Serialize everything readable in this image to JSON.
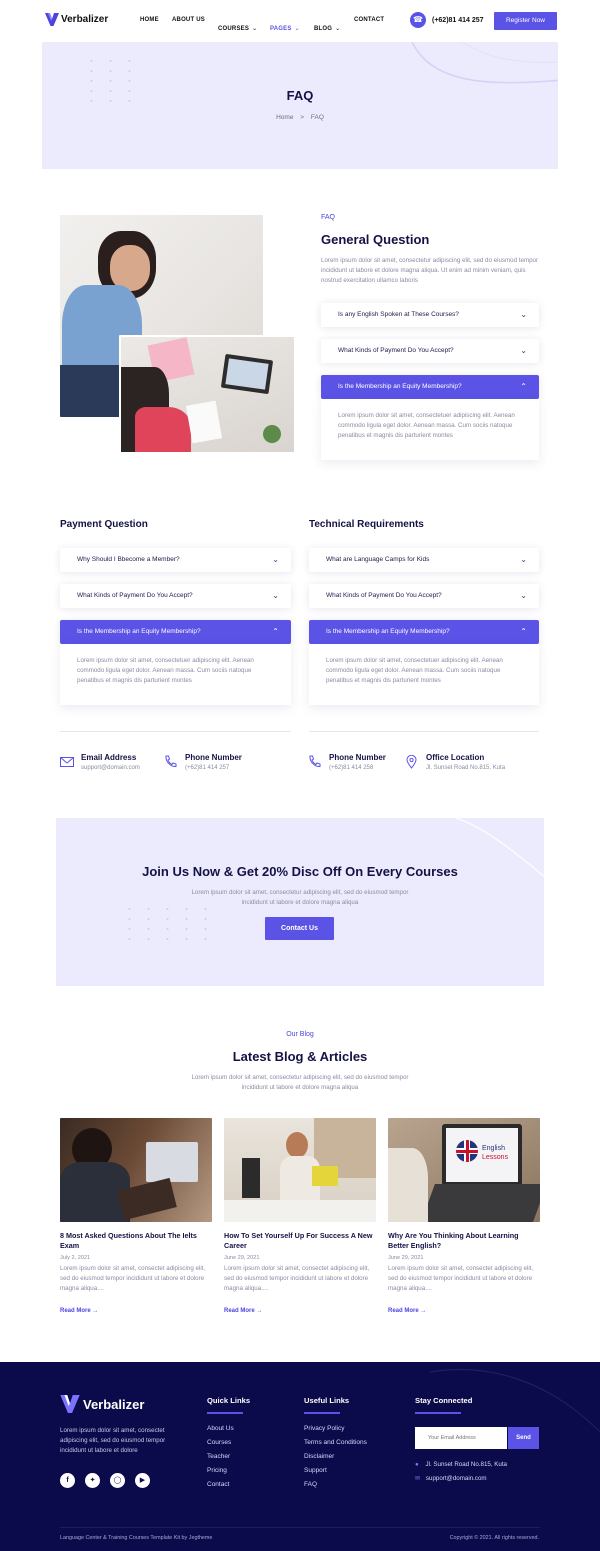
{
  "header": {
    "brand": "Verbalizer",
    "nav": [
      {
        "label": "HOME"
      },
      {
        "label": "ABOUT US"
      },
      {
        "label": "COURSES"
      },
      {
        "label": "PAGES"
      },
      {
        "label": "BLOG"
      },
      {
        "label": "CONTACT"
      }
    ],
    "phone": "(+62)81 414 257",
    "register_label": "Register Now",
    "active_color": "#5a53e6"
  },
  "hero": {
    "title": "FAQ",
    "breadcrumb_home": "Home",
    "breadcrumb_sep": ">",
    "breadcrumb_current": "FAQ"
  },
  "general": {
    "kicker": "FAQ",
    "title": "General Question",
    "intro": "Lorem ipsum dolor sit amet, consectetur adipiscing elit, sed do eiusmod tempor incididunt ut labore et dolore magna aliqua. Ut enim ad minim veniam, quis nostrud exercitation ullamco laboris",
    "items": [
      {
        "q": "Is any English Spoken at These Courses?"
      },
      {
        "q": "What Kinds of Payment Do You Accept?"
      },
      {
        "q": "Is the Membership an Equity Membership?"
      }
    ],
    "answer": "Lorem ipsum dolor sit amet, consectetuer adipiscing elit. Aenean commodo ligula eget dolor. Aenean massa. Cum sociis natoque penatibus et magnis dis parturient montes"
  },
  "payment": {
    "title": "Payment Question",
    "items": [
      {
        "q": "Why Should I Bbecome a Member?"
      },
      {
        "q": "What Kinds of Payment Do You Accept?"
      },
      {
        "q": "Is the Membership an Equity Membership?"
      }
    ],
    "answer": "Lorem ipsum dolor sit amet, consectetuer adipiscing elit. Aenean commodo ligula eget dolor. Aenean massa. Cum sociis natoque penatibus et magnis dis parturient montes"
  },
  "technical": {
    "title": "Technical Requirements",
    "items": [
      {
        "q": "What are Language Camps for Kids"
      },
      {
        "q": "What Kinds of Payment Do You Accept?"
      },
      {
        "q": "Is the Membership an Equity Membership?"
      }
    ],
    "answer": "Lorem ipsum dolor sit amet, consectetuer adipiscing elit. Aenean commodo ligula eget dolor. Aenean massa. Cum sociis natoque penatibus et magnis dis parturient montes"
  },
  "contacts": [
    {
      "label": "Email Address",
      "value": "support@domain.com",
      "icon": "mail-icon"
    },
    {
      "label": "Phone Number",
      "value": "(+62)81 414 257",
      "icon": "phone-icon"
    },
    {
      "label": "Phone Number",
      "value": "(+62)81 414 258",
      "icon": "phone-icon"
    },
    {
      "label": "Office Location",
      "value": "Jl. Sunset Road No.815, Kuta",
      "icon": "location-pin-icon"
    }
  ],
  "cta": {
    "title": "Join Us Now & Get 20% Disc Off On Every Courses",
    "text": "Lorem ipsum dolor sit amet, consectetur adipiscing elit, sed do eiusmod tempor incididunt ut labore et dolore magna aliqua",
    "button": "Contact Us"
  },
  "blog": {
    "kicker": "Our Blog",
    "title": "Latest Blog & Articles",
    "text": "Lorem ipsum dolor sit amet, consectetur adipiscing elit, sed do eiusmod tempor incididunt ut labore et dolore magna aliqua",
    "read_more": "Read More",
    "posts": [
      {
        "title": "8 Most Asked Questions About The Ielts Exam",
        "date": "July 2, 2021",
        "excerpt": "Lorem ipsum dolor sit amet, consectet adipiscing elit, sed do eiusmod tempor incididunt ut labore et dolore magna aliqua...."
      },
      {
        "title": "How To Set Yourself Up For Success A New Career",
        "date": "June 29, 2021",
        "excerpt": "Lorem ipsum dolor sit amet, consectet adipiscing elit, sed do eiusmod tempor incididunt ut labore et dolore magna aliqua...."
      },
      {
        "title": "Why Are You Thinking About Learning Better English?",
        "date": "June 29, 2021",
        "excerpt": "Lorem ipsum dolor sit amet, consectet adipiscing elit, sed do eiusmod tempor incididunt ut labore et dolore magna aliqua...."
      }
    ],
    "laptop_text_1": "English",
    "laptop_text_2": "Lessons"
  },
  "footer": {
    "brand": "Verbalizer",
    "about": "Lorem ipsum dolor sit amet, consectet adipiscing elit, sed do eiusmod tempor incididunt ut labore et dolore",
    "quick_title": "Quick Links",
    "quick": [
      "About Us",
      "Courses",
      "Teacher",
      "Pricing",
      "Contact"
    ],
    "useful_title": "Useful Links",
    "useful": [
      "Privacy Policy",
      "Terms and Conditions",
      "Disclaimer",
      "Support",
      "FAQ"
    ],
    "stay_title": "Stay Connected",
    "email_placeholder": "Your Email Address",
    "send": "Send",
    "address": "Jl. Sunset Road No.815, Kuta",
    "email": "support@domain.com",
    "copyright_left": "Language Center & Training Courses Template Kit by Jegtheme",
    "copyright_right": "Copyright © 2021. All rights reserved."
  }
}
